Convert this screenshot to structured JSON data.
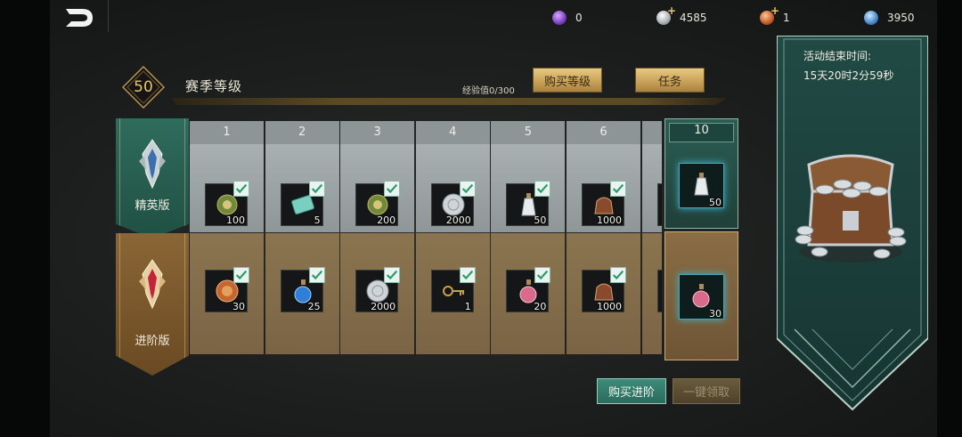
{
  "topbar": {
    "currencies": [
      {
        "name": "purple-gem",
        "value": "0",
        "color": "#8a4fc9",
        "has_plus": false
      },
      {
        "name": "silver-coin",
        "value": "4585",
        "color": "#b9bdc2",
        "has_plus": true
      },
      {
        "name": "bronze-token",
        "value": "1",
        "color": "#d0703a",
        "has_plus": true
      },
      {
        "name": "blue-crystal",
        "value": "3950",
        "color": "#4f8fd0",
        "has_plus": false
      }
    ]
  },
  "header": {
    "level": "50",
    "title": "赛季等级",
    "exp": "经验值0/300",
    "buy_level_label": "购买等级",
    "tasks_label": "任务"
  },
  "rows": {
    "elite_label": "精英版",
    "advanced_label": "进阶版"
  },
  "levels": [
    {
      "num": "1",
      "elite": {
        "icon": "green-orb",
        "count": "100",
        "claimed": true
      },
      "adv": {
        "icon": "bronze-coin",
        "count": "30",
        "claimed": true
      }
    },
    {
      "num": "2",
      "elite": {
        "icon": "jade-scroll",
        "count": "5",
        "claimed": true
      },
      "adv": {
        "icon": "blue-potion",
        "count": "25",
        "claimed": true
      }
    },
    {
      "num": "3",
      "elite": {
        "icon": "green-orb",
        "count": "200",
        "claimed": true
      },
      "adv": {
        "icon": "silver-coin",
        "count": "2000",
        "claimed": true
      }
    },
    {
      "num": "4",
      "elite": {
        "icon": "silver-coin",
        "count": "2000",
        "claimed": true
      },
      "adv": {
        "icon": "golden-key",
        "count": "1",
        "claimed": true
      }
    },
    {
      "num": "5",
      "elite": {
        "icon": "white-potion",
        "count": "50",
        "claimed": true
      },
      "adv": {
        "icon": "pink-potion",
        "count": "20",
        "claimed": true
      }
    },
    {
      "num": "6",
      "elite": {
        "icon": "leather-pouch",
        "count": "1000",
        "claimed": true
      },
      "adv": {
        "icon": "leather-pouch",
        "count": "1000",
        "claimed": true
      }
    }
  ],
  "level10": {
    "num": "10",
    "elite": {
      "icon": "white-potion",
      "count": "50"
    },
    "adv": {
      "icon": "pink-potion",
      "count": "30"
    }
  },
  "footer": {
    "buy_advanced_label": "购买进阶",
    "claim_all_label": "一键领取"
  },
  "banner": {
    "end_label": "活动结束时间:",
    "countdown": "15天20时2分59秒",
    "reward_icon": "treasure-chest-icon"
  }
}
